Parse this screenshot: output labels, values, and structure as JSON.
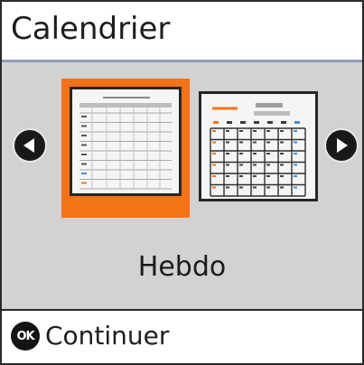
{
  "header": {
    "title": "Calendrier"
  },
  "carousel": {
    "options": [
      {
        "id": "weekly",
        "selected": true,
        "icon": "weekly-calendar-thumbnail"
      },
      {
        "id": "monthly",
        "selected": false,
        "icon": "monthly-calendar-thumbnail"
      }
    ],
    "current_label": "Hebdo",
    "prev_icon": "chevron-left-icon",
    "next_icon": "chevron-right-icon"
  },
  "footer": {
    "ok_badge": "OK",
    "action_label": "Continuer"
  },
  "colors": {
    "accent": "#f57317",
    "header_rule": "#8f9fb7",
    "background": "#d2d2d2"
  }
}
